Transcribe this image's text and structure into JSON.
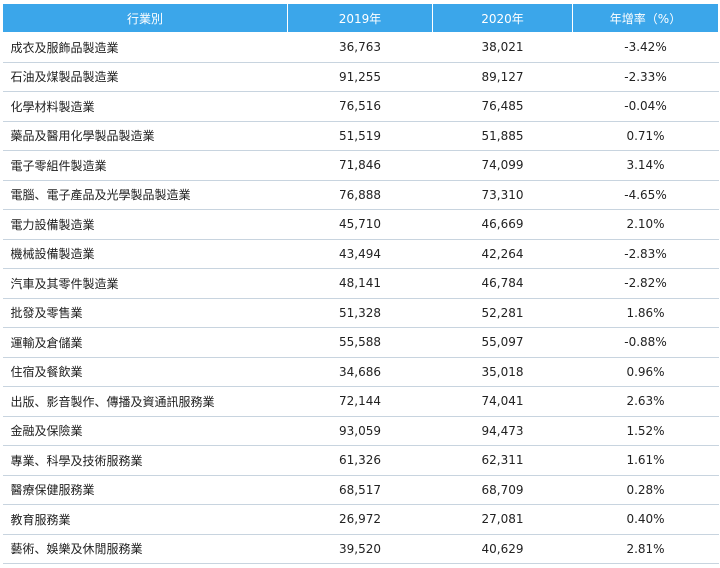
{
  "table": {
    "headers": [
      "行業別",
      "2019年",
      "2020年",
      "年增率（%）"
    ],
    "rows": [
      {
        "industry": "成衣及服飾品製造業",
        "y2019": "36,763",
        "y2020": "38,021",
        "growth": "-3.42%"
      },
      {
        "industry": "石油及煤製品製造業",
        "y2019": "91,255",
        "y2020": "89,127",
        "growth": "-2.33%"
      },
      {
        "industry": "化學材料製造業",
        "y2019": "76,516",
        "y2020": "76,485",
        "growth": "-0.04%"
      },
      {
        "industry": "藥品及醫用化學製品製造業",
        "y2019": "51,519",
        "y2020": "51,885",
        "growth": "0.71%"
      },
      {
        "industry": "電子零組件製造業",
        "y2019": "71,846",
        "y2020": "74,099",
        "growth": "3.14%"
      },
      {
        "industry": "電腦、電子產品及光學製品製造業",
        "y2019": "76,888",
        "y2020": "73,310",
        "growth": "-4.65%"
      },
      {
        "industry": "電力設備製造業",
        "y2019": "45,710",
        "y2020": "46,669",
        "growth": "2.10%"
      },
      {
        "industry": "機械設備製造業",
        "y2019": "43,494",
        "y2020": "42,264",
        "growth": "-2.83%"
      },
      {
        "industry": "汽車及其零件製造業",
        "y2019": "48,141",
        "y2020": "46,784",
        "growth": "-2.82%"
      },
      {
        "industry": "批發及零售業",
        "y2019": "51,328",
        "y2020": "52,281",
        "growth": "1.86%"
      },
      {
        "industry": "運輸及倉儲業",
        "y2019": "55,588",
        "y2020": "55,097",
        "growth": "-0.88%"
      },
      {
        "industry": "住宿及餐飲業",
        "y2019": "34,686",
        "y2020": "35,018",
        "growth": "0.96%"
      },
      {
        "industry": "出版、影音製作、傳播及資通訊服務業",
        "y2019": "72,144",
        "y2020": "74,041",
        "growth": "2.63%"
      },
      {
        "industry": "金融及保險業",
        "y2019": "93,059",
        "y2020": "94,473",
        "growth": "1.52%"
      },
      {
        "industry": "專業、科學及技術服務業",
        "y2019": "61,326",
        "y2020": "62,311",
        "growth": "1.61%"
      },
      {
        "industry": "醫療保健服務業",
        "y2019": "68,517",
        "y2020": "68,709",
        "growth": "0.28%"
      },
      {
        "industry": "教育服務業",
        "y2019": "26,972",
        "y2020": "27,081",
        "growth": "0.40%"
      },
      {
        "industry": "藝術、娛樂及休閒服務業",
        "y2019": "39,520",
        "y2020": "40,629",
        "growth": "2.81%"
      }
    ]
  },
  "colors": {
    "header_bg": "#3ba6ea",
    "header_text": "#ffffff",
    "row_divider": "#c8d4df",
    "text": "#222222"
  }
}
